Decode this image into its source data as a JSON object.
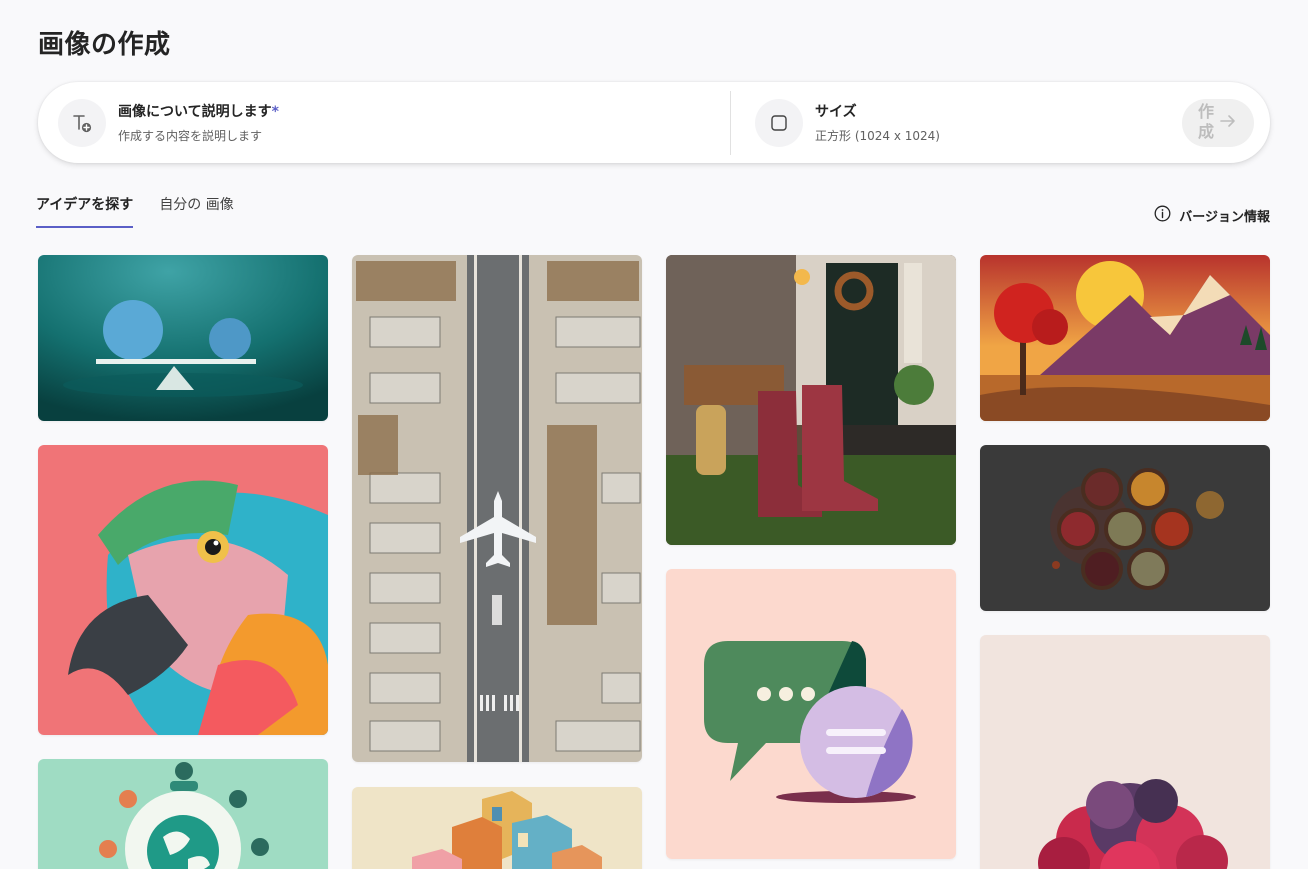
{
  "page": {
    "title": "画像の作成"
  },
  "prompt": {
    "label": "画像について説明します",
    "required_mark": "*",
    "placeholder": "作成する内容を説明します",
    "icon": "text-add-icon"
  },
  "size": {
    "label": "サイズ",
    "value": "正方形 (1024 x 1024)",
    "icon": "square-icon"
  },
  "create_button": {
    "label": "作成",
    "icon": "arrow-right-icon"
  },
  "tabs": [
    {
      "label": "アイデアを探す",
      "active": true
    },
    {
      "label": "自分の 画像",
      "active": false
    }
  ],
  "version_info": {
    "label": "バージョン情報",
    "icon": "info-icon"
  },
  "gallery": [
    {
      "subject": "balance-scale-spheres"
    },
    {
      "subject": "parrot"
    },
    {
      "subject": "globe-people"
    },
    {
      "subject": "airport-aerial"
    },
    {
      "subject": "isometric-city"
    },
    {
      "subject": "porch-rain-boots"
    },
    {
      "subject": "chat-bubbles"
    },
    {
      "subject": "mountain-sunset"
    },
    {
      "subject": "spice-bowls"
    },
    {
      "subject": "pink-cloud"
    }
  ],
  "colors": {
    "accent": "#5b5fc7",
    "background": "#f9f9fb"
  }
}
